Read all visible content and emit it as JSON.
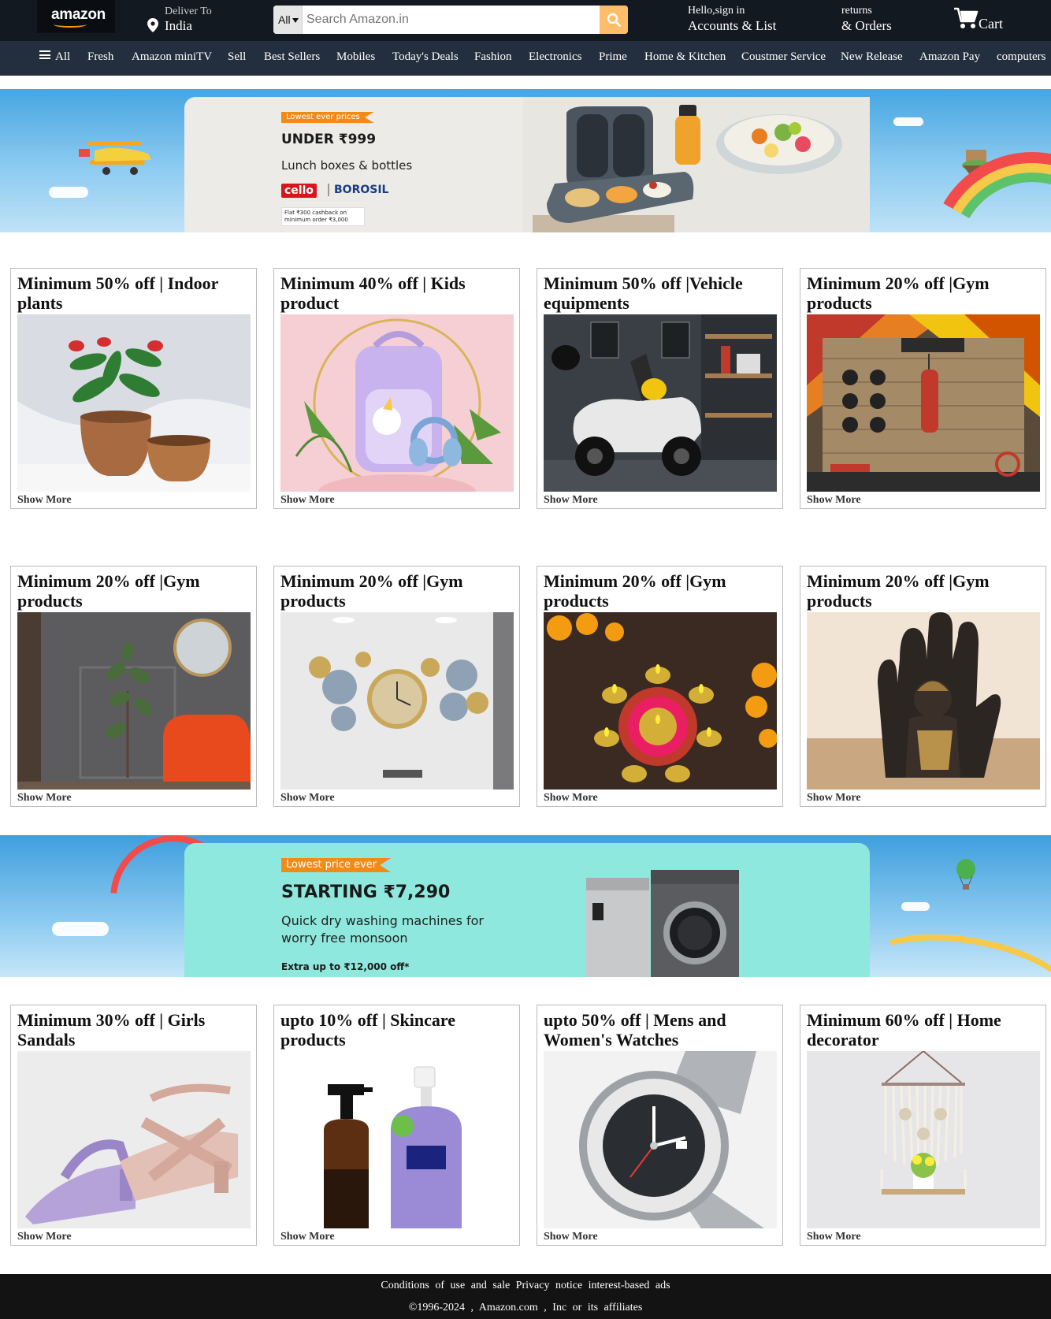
{
  "header": {
    "logo": "amazon",
    "deliver_label": "Deliver To",
    "deliver_location": "India",
    "search_category": "All",
    "search_placeholder": "Search Amazon.in",
    "account_greeting": "Hello,sign in",
    "account_label": "Accounts & List",
    "returns_label": "returns",
    "orders_label": "& Orders",
    "cart_label": "Cart"
  },
  "nav": {
    "all_label": "All",
    "items": [
      "Fresh",
      "Amazon miniTV",
      "Sell",
      "Best Sellers",
      "Mobiles",
      "Today's Deals",
      "Fashion",
      "Electronics",
      "Prime",
      "Home & Kitchen",
      "Coustmer Service",
      "New Release",
      "Amazon Pay",
      "computers"
    ]
  },
  "banner_top": {
    "tag": "Lowest ever prices",
    "headline": "UNDER ₹999",
    "subline": "Lunch boxes & bottles",
    "brand_1": "cello",
    "brand_2": "BOROSIL",
    "fineprint": "Flat ₹300 cashback on minimum order ₹3,000"
  },
  "banner_mid": {
    "tag": "Lowest price ever",
    "headline": "STARTING ₹7,290",
    "subline": "Quick dry washing machines for worry free monsoon",
    "extra": "Extra up to ₹12,000 off*"
  },
  "cards_row1": [
    {
      "title": "Minimum 50% off | Indoor plants",
      "link": "Show More",
      "image": "indoor-plant"
    },
    {
      "title": "Minimum 40% off | Kids product",
      "link": "Show More",
      "image": "kids-backpack"
    },
    {
      "title": "Minimum 50% off |Vehicle equipments",
      "link": "Show More",
      "image": "scooter-garage"
    },
    {
      "title": "Minimum 20% off |Gym products",
      "link": "Show More",
      "image": "gym-room"
    }
  ],
  "cards_row2": [
    {
      "title": "Minimum 20% off |Gym products",
      "link": "Show More",
      "image": "room-decor"
    },
    {
      "title": "Minimum 20% off |Gym products",
      "link": "Show More",
      "image": "wall-clock"
    },
    {
      "title": "Minimum 20% off |Gym products",
      "link": "Show More",
      "image": "diyas"
    },
    {
      "title": "Minimum 20% off |Gym products",
      "link": "Show More",
      "image": "buddha-statue"
    }
  ],
  "cards_row3": [
    {
      "title": "Minimum 30% off | Girls Sandals",
      "link": "Show More",
      "image": "sandals"
    },
    {
      "title": "upto 10% off | Skincare products",
      "link": "Show More",
      "image": "skincare-bottles"
    },
    {
      "title": "upto 50% off | Mens and Women's Watches",
      "link": "Show More",
      "image": "watch"
    },
    {
      "title": "Minimum 60% off | Home decorator",
      "link": "Show More",
      "image": "macrame-shelf"
    }
  ],
  "footer": {
    "links": "Conditions of use and sale Privacy notice interest-based ads",
    "copyright": "©1996-2024 , Amazon.com , Inc or its affiliates"
  },
  "colors": {
    "header_bg": "#131921",
    "nav_bg": "#232f3e",
    "search_button": "#febd69",
    "accent_orange": "#ff9900",
    "footer_bg": "#131313"
  }
}
